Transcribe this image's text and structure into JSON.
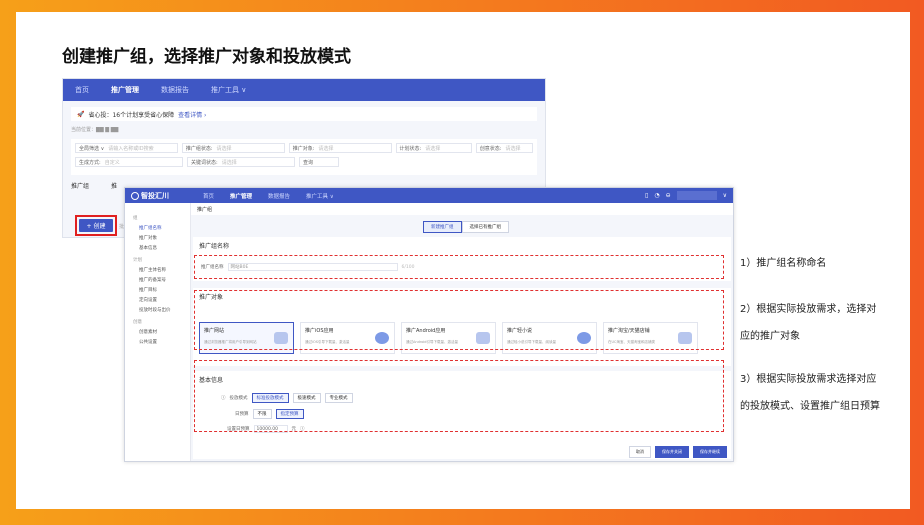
{
  "slide": {
    "title": "创建推广组，选择推广对象和投放模式",
    "notes": [
      "1）推广组名称命名",
      "2）根据实际投放需求，选择对应的推广对象",
      "3）根据实际投放需求选择对应的投放模式、设置推广组日预算"
    ]
  },
  "back_shot": {
    "nav": [
      "首页",
      "推广管理",
      "数据报告",
      "推广工具 ∨"
    ],
    "notice": "省心投：16个计划享受省心保障",
    "notice_link": "查看详情 ›",
    "crumb": "当前位置：▇▇ ▇ ▇▇",
    "filters_row1": [
      {
        "label": "全局筛选 ∨",
        "placeholder": "请输入名称或ID搜索"
      },
      {
        "label": "推广组状态:",
        "placeholder": "请选择"
      },
      {
        "label": "推广对象:",
        "placeholder": "请选择"
      },
      {
        "label": "计划状态:",
        "placeholder": "请选择"
      },
      {
        "label": "创意状态:",
        "placeholder": "请选择"
      }
    ],
    "filters_row2": [
      {
        "label": "生成方式:",
        "placeholder": "自定义"
      },
      {
        "label": "关键词状态:",
        "placeholder": "请选择"
      },
      {
        "label": "查询",
        "placeholder": ""
      }
    ],
    "tabs": [
      "推广组",
      "推"
    ],
    "create_button": "+ 创建",
    "tip": "批量"
  },
  "front_shot": {
    "logo": "智投汇川",
    "nav": [
      "首页",
      "推广管理",
      "数据报告",
      "推广工具 ∨"
    ],
    "sidebar": [
      {
        "type": "sec",
        "label": "组"
      },
      {
        "type": "it",
        "label": "推广组名称",
        "active": true
      },
      {
        "type": "it",
        "label": "推广对象"
      },
      {
        "type": "it",
        "label": "基本信息"
      },
      {
        "type": "sec",
        "label": "计划"
      },
      {
        "type": "it",
        "label": "推广主体名称"
      },
      {
        "type": "it",
        "label": "推广的备案号"
      },
      {
        "type": "it",
        "label": "推广目标"
      },
      {
        "type": "it",
        "label": "定向设置"
      },
      {
        "type": "it",
        "label": "投放时段与出价"
      },
      {
        "type": "sec",
        "label": "创意"
      },
      {
        "type": "it",
        "label": "创意素材"
      },
      {
        "type": "it",
        "label": "公共设置"
      }
    ],
    "breadcrumb": "推广组",
    "toggle": [
      "新建推广组",
      "选择已有推广组"
    ],
    "section1": {
      "title": "推广组名称",
      "field_label": "推广组名称",
      "field_value": "网站B0E",
      "count": "6/100"
    },
    "section2": {
      "title": "推广对象",
      "cards": [
        {
          "title": "推广网站",
          "desc": "通过浏览器推广将用户引导到网站",
          "selected": true
        },
        {
          "title": "推广iOS应用",
          "desc": "通过iOS引导下载量、激活量"
        },
        {
          "title": "推广Android应用",
          "desc": "通过Android引导下载量、激活量"
        },
        {
          "title": "推广轻小说",
          "desc": "通过轻小说引导下载量、阅读量"
        },
        {
          "title": "推广淘宝/天猫店铺",
          "desc": "在UC淘宝、天猫淘宝和店铺类"
        }
      ]
    },
    "section3": {
      "title": "基本信息",
      "mode_label": "投放模式",
      "modes": [
        "标准投放模式",
        "极速模式",
        "专业模式"
      ],
      "budget_label": "日预算",
      "budget_options": [
        "不限",
        "指定预算"
      ],
      "set_label": "设置日预算",
      "budget_value": "10000.00",
      "unit": "元"
    },
    "footer": [
      "取消",
      "保存并关闭",
      "保存并继续"
    ]
  }
}
